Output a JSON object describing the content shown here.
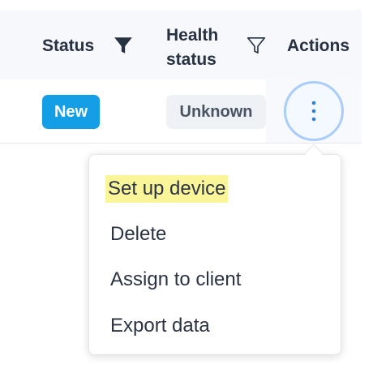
{
  "table": {
    "headers": {
      "status": "Status",
      "health_line1": "Health",
      "health_line2": "status",
      "actions": "Actions"
    },
    "row": {
      "status": "New",
      "health_status": "Unknown"
    }
  },
  "icons": {
    "status_filter": "filter-filled-icon",
    "health_filter": "filter-outline-icon",
    "row_actions": "kebab-menu-icon"
  },
  "colors": {
    "badge_new": "#139ee6",
    "badge_unknown_bg": "#eef1f6",
    "menu_highlight": "#fbf59a",
    "focus_ring": "#a9cdf8",
    "kebab_dots": "#2f7fd9"
  },
  "menu": {
    "items": [
      "Set up device",
      "Delete",
      "Assign to client",
      "Export data"
    ]
  }
}
